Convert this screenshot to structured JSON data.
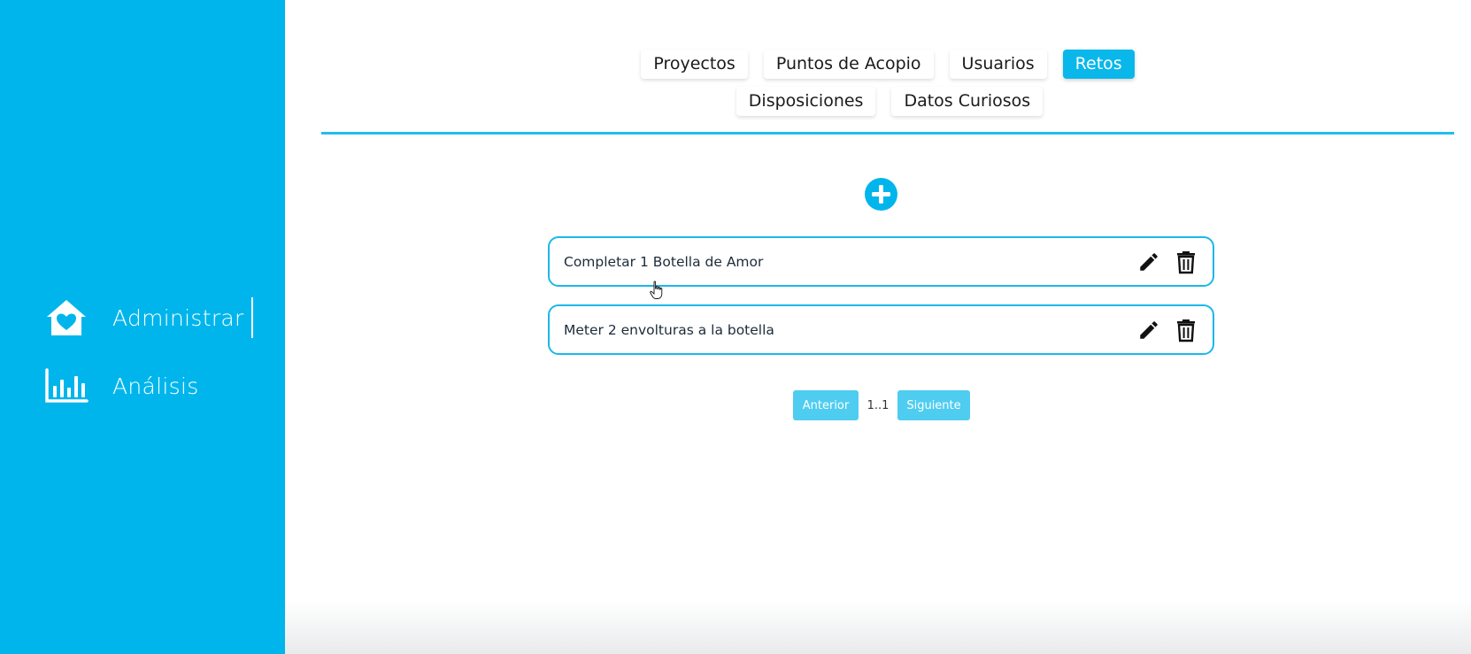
{
  "sidebar": {
    "items": [
      {
        "label": "Administrar",
        "icon": "home-heart-icon",
        "active": true
      },
      {
        "label": "Análisis",
        "icon": "bar-chart-icon",
        "active": false
      }
    ]
  },
  "tabs": {
    "row1": [
      "Proyectos",
      "Puntos de Acopio",
      "Usuarios",
      "Retos"
    ],
    "row2": [
      "Disposiciones",
      "Datos Curiosos"
    ],
    "active": "Retos"
  },
  "add_button": {
    "icon": "plus-circle-icon"
  },
  "challenges": [
    {
      "text": "Completar 1 Botella de Amor"
    },
    {
      "text": "Meter 2 envolturas a la botella"
    }
  ],
  "pagination": {
    "prev_label": "Anterior",
    "page_info": "1..1",
    "next_label": "Siguiente"
  },
  "colors": {
    "accent": "#00b5ec",
    "tab_active": "#0ab7ea",
    "pager_button": "#4fcdf0"
  }
}
